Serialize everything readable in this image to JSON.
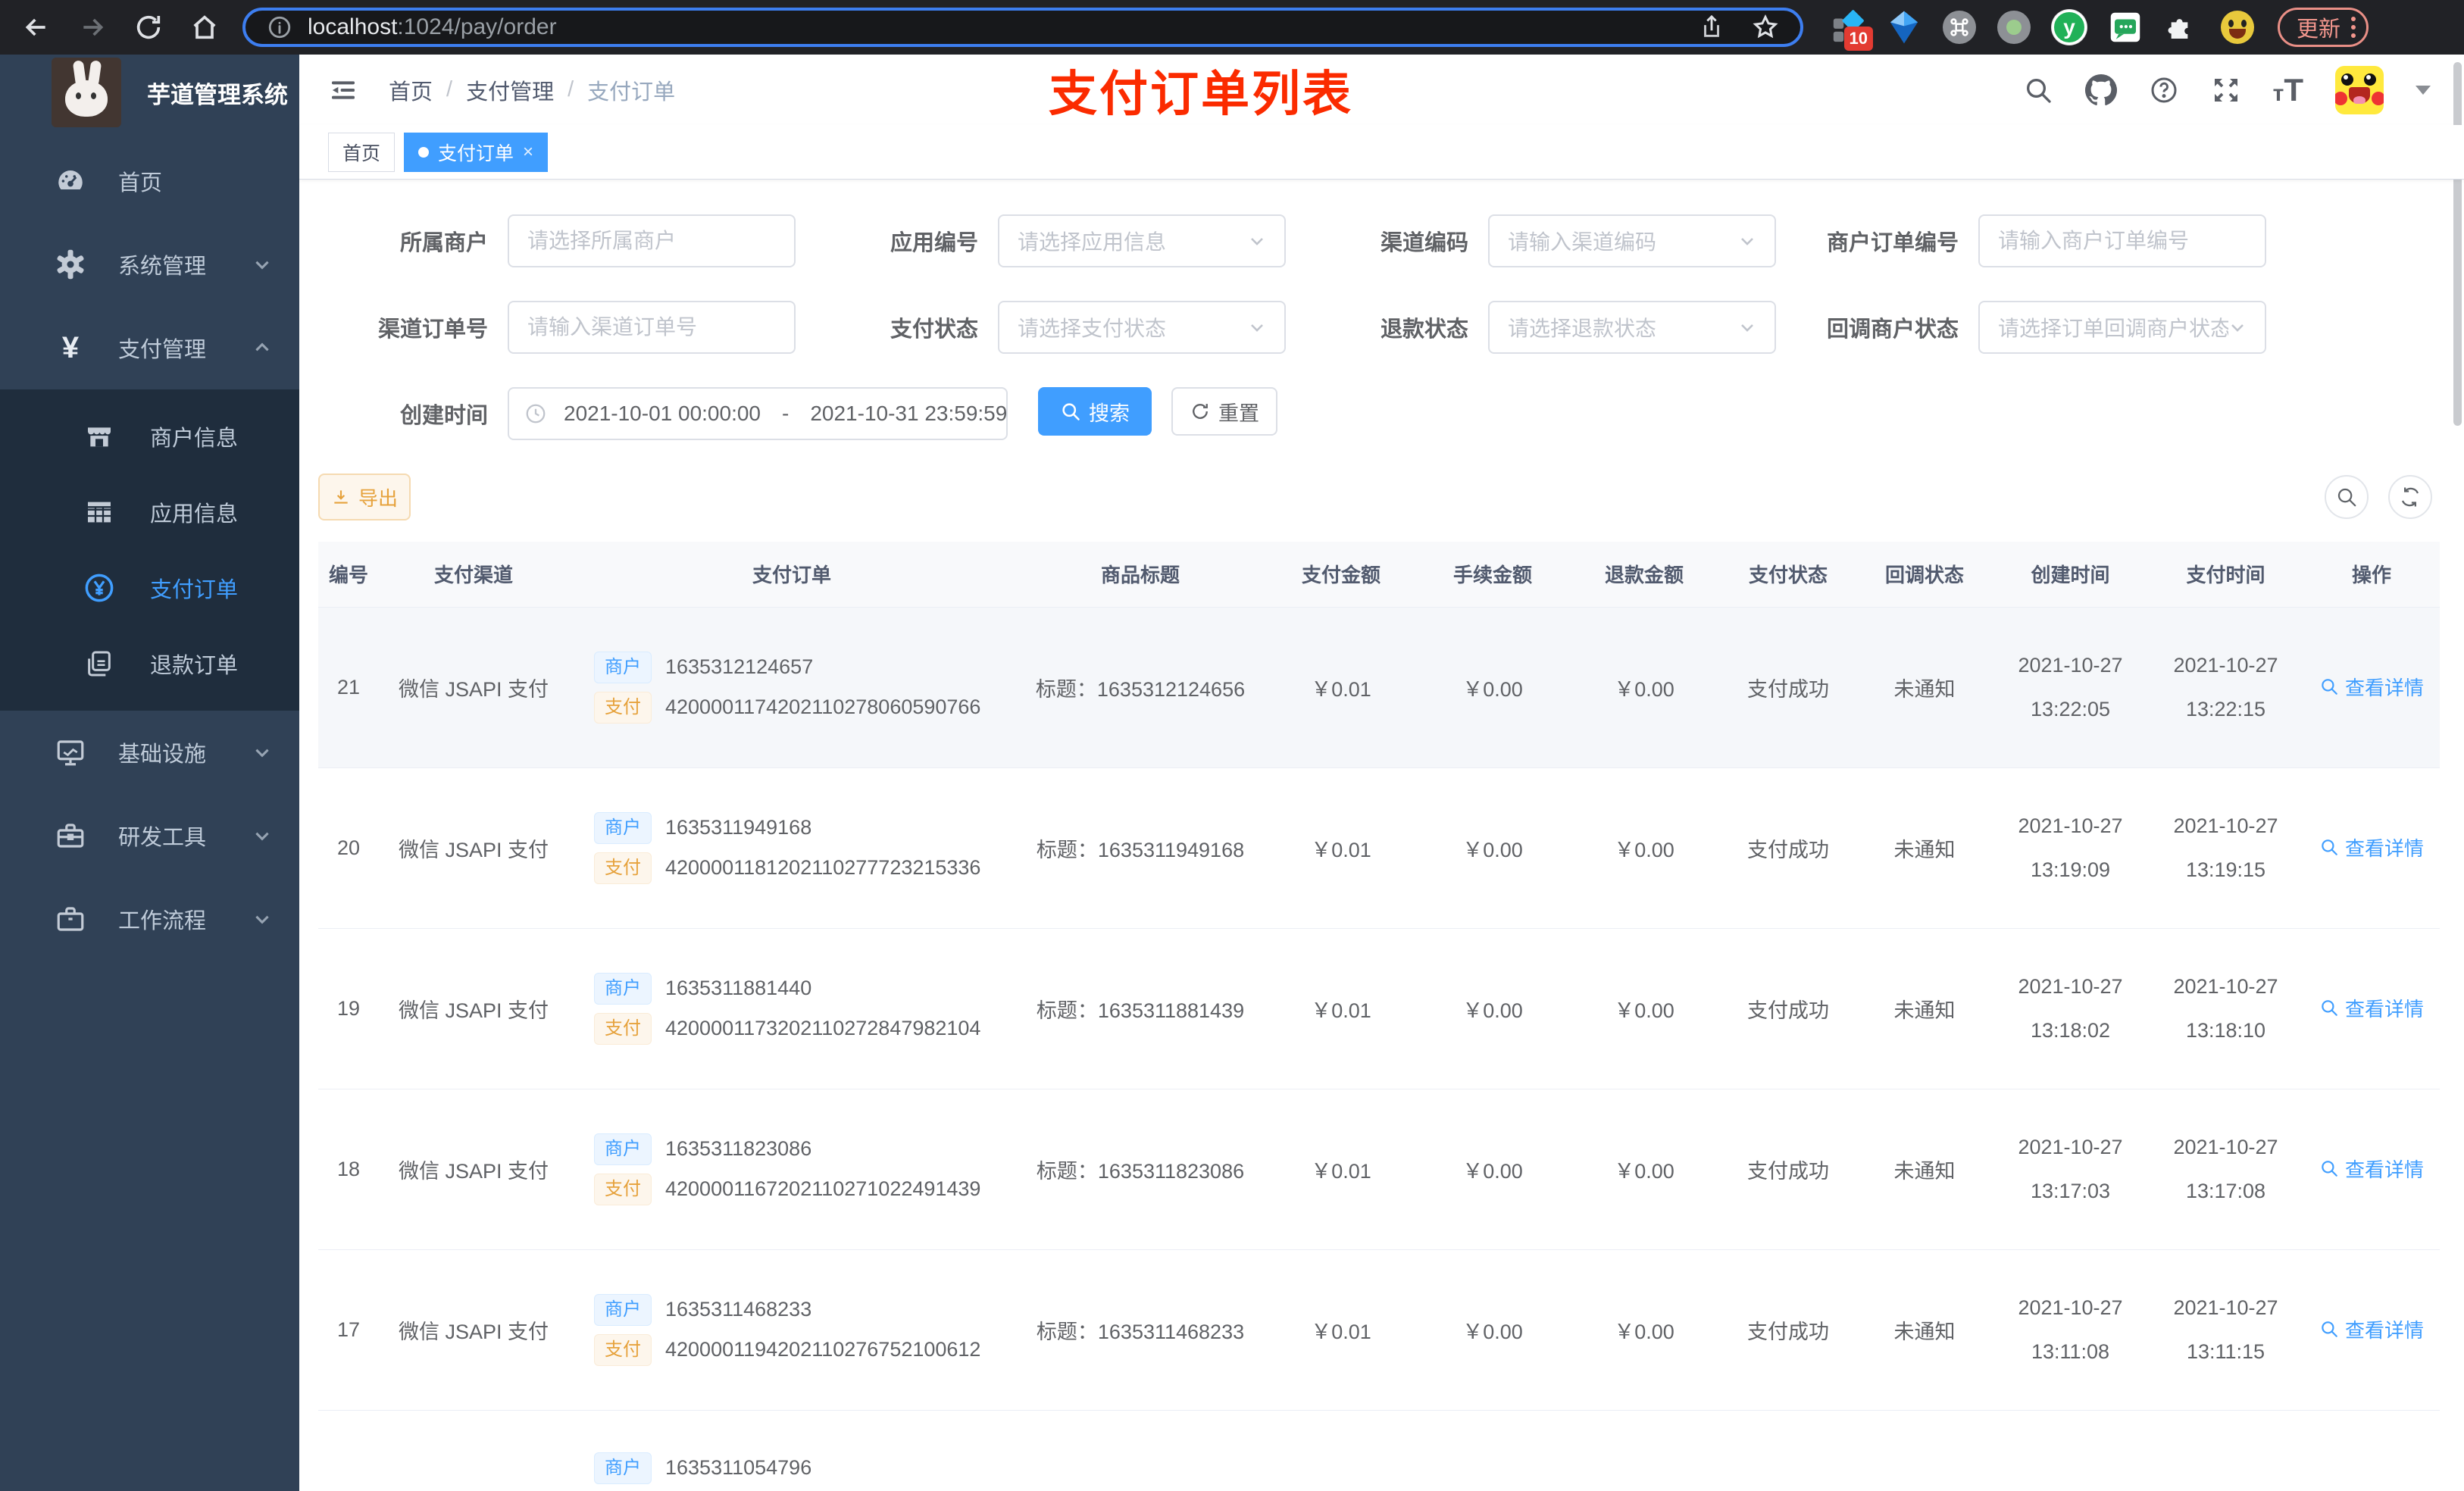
{
  "browser": {
    "url_host": "localhost",
    "url_rest": ":1024/pay/order",
    "ext_badge": "10",
    "update_label": "更新"
  },
  "sidebar": {
    "title": "芋道管理系统",
    "top": [
      {
        "label": "首页"
      },
      {
        "label": "系统管理"
      },
      {
        "label": "支付管理"
      }
    ],
    "sub": [
      {
        "label": "商户信息"
      },
      {
        "label": "应用信息"
      },
      {
        "label": "支付订单"
      },
      {
        "label": "退款订单"
      }
    ],
    "lower": [
      {
        "label": "基础设施"
      },
      {
        "label": "研发工具"
      },
      {
        "label": "工作流程"
      }
    ]
  },
  "header": {
    "breadcrumb": [
      "首页",
      "支付管理",
      "支付订单"
    ],
    "annotation": "支付订单列表"
  },
  "tabs": [
    {
      "label": "首页"
    },
    {
      "label": "支付订单"
    }
  ],
  "filters": {
    "fields": [
      {
        "label": "所属商户",
        "placeholder": "请选择所属商户"
      },
      {
        "label": "应用编号",
        "placeholder": "请选择应用信息"
      },
      {
        "label": "渠道编码",
        "placeholder": "请输入渠道编码"
      },
      {
        "label": "商户订单编号",
        "placeholder": "请输入商户订单编号"
      },
      {
        "label": "渠道订单号",
        "placeholder": "请输入渠道订单号"
      },
      {
        "label": "支付状态",
        "placeholder": "请选择支付状态"
      },
      {
        "label": "退款状态",
        "placeholder": "请选择退款状态"
      },
      {
        "label": "回调商户状态",
        "placeholder": "请选择订单回调商户状态"
      }
    ],
    "date": {
      "label": "创建时间",
      "start": "2021-10-01 00:00:00",
      "separator": "-",
      "end": "2021-10-31 23:59:59"
    },
    "search_label": "搜索",
    "reset_label": "重置",
    "export_label": "导出"
  },
  "table": {
    "columns": [
      "编号",
      "支付渠道",
      "支付订单",
      "商品标题",
      "支付金额",
      "手续金额",
      "退款金额",
      "支付状态",
      "回调状态",
      "创建时间",
      "支付时间",
      "操作"
    ],
    "tags": {
      "merchant": "商户",
      "pay": "支付"
    },
    "rows": [
      {
        "id": "21",
        "channel": "微信 JSAPI 支付",
        "merchant_no": "1635312124657",
        "pay_no": "4200001174202110278060590766",
        "title": "标题：1635312124656",
        "amount": "￥0.01",
        "fee": "￥0.00",
        "refund": "￥0.00",
        "status": "支付成功",
        "notify": "未通知",
        "created": "2021-10-27 13:22:05",
        "paid": "2021-10-27 13:22:15",
        "action": "查看详情"
      },
      {
        "id": "20",
        "channel": "微信 JSAPI 支付",
        "merchant_no": "1635311949168",
        "pay_no": "4200001181202110277723215336",
        "title": "标题：1635311949168",
        "amount": "￥0.01",
        "fee": "￥0.00",
        "refund": "￥0.00",
        "status": "支付成功",
        "notify": "未通知",
        "created": "2021-10-27 13:19:09",
        "paid": "2021-10-27 13:19:15",
        "action": "查看详情"
      },
      {
        "id": "19",
        "channel": "微信 JSAPI 支付",
        "merchant_no": "1635311881440",
        "pay_no": "4200001173202110272847982104",
        "title": "标题：1635311881439",
        "amount": "￥0.01",
        "fee": "￥0.00",
        "refund": "￥0.00",
        "status": "支付成功",
        "notify": "未通知",
        "created": "2021-10-27 13:18:02",
        "paid": "2021-10-27 13:18:10",
        "action": "查看详情"
      },
      {
        "id": "18",
        "channel": "微信 JSAPI 支付",
        "merchant_no": "1635311823086",
        "pay_no": "4200001167202110271022491439",
        "title": "标题：1635311823086",
        "amount": "￥0.01",
        "fee": "￥0.00",
        "refund": "￥0.00",
        "status": "支付成功",
        "notify": "未通知",
        "created": "2021-10-27 13:17:03",
        "paid": "2021-10-27 13:17:08",
        "action": "查看详情"
      },
      {
        "id": "17",
        "channel": "微信 JSAPI 支付",
        "merchant_no": "1635311468233",
        "pay_no": "4200001194202110276752100612",
        "title": "标题：1635311468233",
        "amount": "￥0.01",
        "fee": "￥0.00",
        "refund": "￥0.00",
        "status": "支付成功",
        "notify": "未通知",
        "created": "2021-10-27 13:11:08",
        "paid": "2021-10-27 13:11:15",
        "action": "查看详情"
      }
    ],
    "extra_row": {
      "merchant_no": "1635311054796"
    }
  },
  "colors": {
    "accent_blue": "#409eff",
    "warning_orange": "#e6a23c",
    "annotation_red": "#fb2b00",
    "sidebar_bg": "#304156",
    "submenu_bg": "#1f2d3d",
    "active_tab_bg": "#409eff"
  }
}
